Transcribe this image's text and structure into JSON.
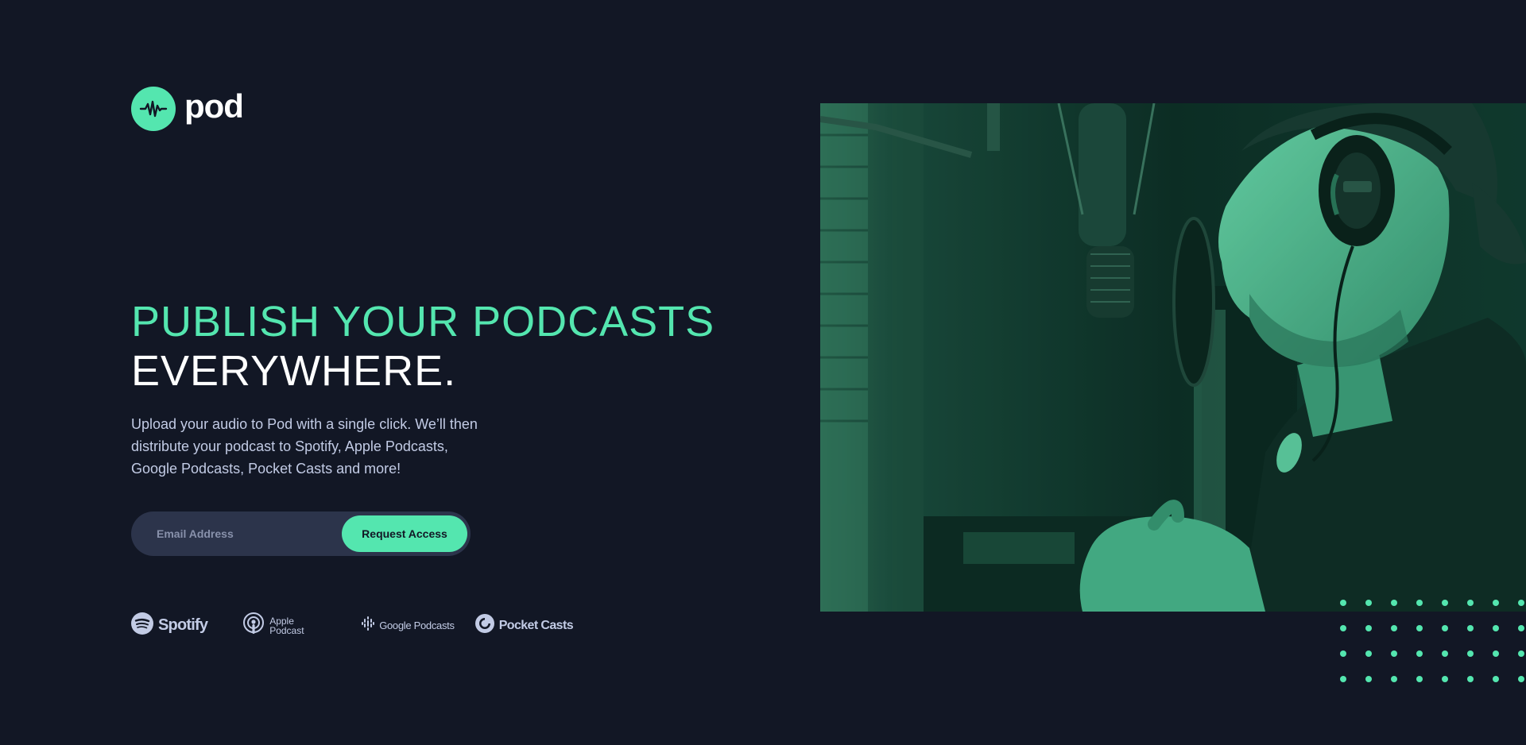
{
  "brand": {
    "name": "pod",
    "icon": "waveform-icon",
    "accent_color": "#54e6af",
    "background_color": "#121725"
  },
  "hero": {
    "headline_accent": "PUBLISH YOUR PODCASTS",
    "headline_light": "EVERYWHERE.",
    "description": "Upload your audio to Pod with a single click. We’ll then distribute your podcast to Spotify, Apple Podcasts, Google Podcasts, Pocket Casts and more!"
  },
  "form": {
    "email_placeholder": "Email Address",
    "email_value": "",
    "submit_label": "Request Access"
  },
  "platforms": [
    {
      "name": "Spotify",
      "icon": "spotify-icon"
    },
    {
      "name": "Apple Podcast",
      "icon": "apple-podcast-icon"
    },
    {
      "name": "Google Podcasts",
      "icon": "google-podcasts-icon"
    },
    {
      "name": "Pocket Casts",
      "icon": "pocket-casts-icon"
    }
  ],
  "image": {
    "subject": "man with headphones speaking into studio microphone",
    "tint_color": "#54e6af"
  }
}
